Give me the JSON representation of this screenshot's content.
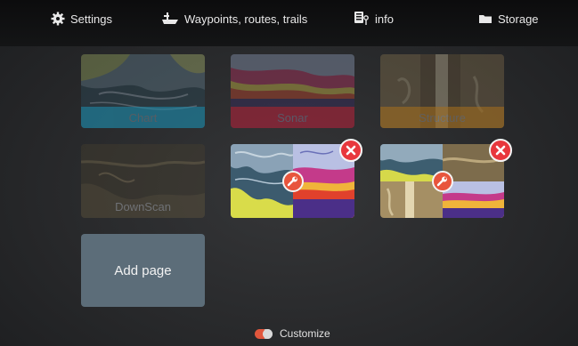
{
  "topbar": {
    "settings_label": "Settings",
    "waypoints_label": "Waypoints, routes, trails",
    "info_label": "info",
    "storage_label": "Storage"
  },
  "tiles": {
    "chart": {
      "label": "Chart",
      "bar_color": "#1c8fb0"
    },
    "sonar": {
      "label": "Sonar",
      "bar_color": "#b8232a"
    },
    "structure": {
      "label": "Structure",
      "bar_color": "#a8701c"
    },
    "downscan": {
      "label": "DownScan"
    }
  },
  "add_page": {
    "label": "Add page"
  },
  "customize": {
    "label": "Customize"
  },
  "icons": {
    "settings": "gear-icon",
    "waypoints": "boat-icon",
    "info": "info-icon",
    "storage": "folder-icon",
    "delete": "close-icon",
    "edit": "wrench-icon",
    "customize": "toggle-icon"
  },
  "colors": {
    "accent": "#e8553d",
    "close": "#e8373d",
    "add_page_bg": "#5c6d79"
  }
}
